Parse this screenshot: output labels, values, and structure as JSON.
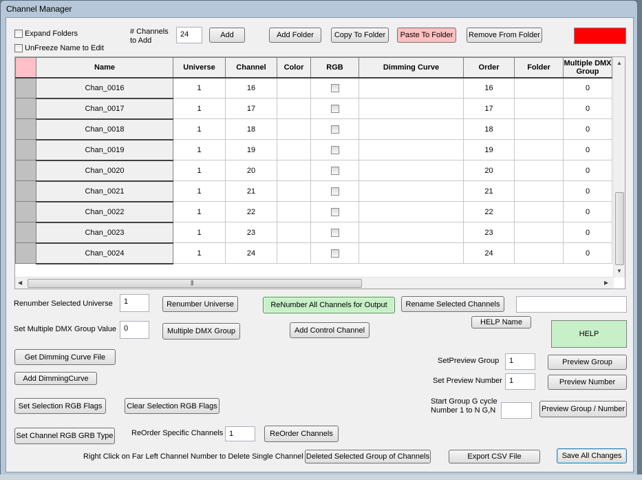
{
  "window": {
    "title": "Channel Manager"
  },
  "top": {
    "expand_folders": "Expand Folders",
    "unfreeze_name": "UnFreeze Name to Edit",
    "channels_to_add_label": "# Channels to Add",
    "channels_to_add_value": "24",
    "add": "Add",
    "add_folder": "Add Folder",
    "copy_to_folder": "Copy To Folder",
    "paste_to_folder": "Paste To Folder",
    "remove_from_folder": "Remove From Folder",
    "color_swatch": "#ff0000"
  },
  "grid": {
    "columns": [
      "",
      "Name",
      "Universe",
      "Channel",
      "Color",
      "RGB",
      "Dimming Curve",
      "Order",
      "Folder",
      "Multiple DMX Group"
    ],
    "rows": [
      {
        "name": "Chan_0016",
        "universe": "1",
        "channel": "16",
        "order": "16",
        "group": "0"
      },
      {
        "name": "Chan_0017",
        "universe": "1",
        "channel": "17",
        "order": "17",
        "group": "0"
      },
      {
        "name": "Chan_0018",
        "universe": "1",
        "channel": "18",
        "order": "18",
        "group": "0"
      },
      {
        "name": "Chan_0019",
        "universe": "1",
        "channel": "19",
        "order": "19",
        "group": "0"
      },
      {
        "name": "Chan_0020",
        "universe": "1",
        "channel": "20",
        "order": "20",
        "group": "0"
      },
      {
        "name": "Chan_0021",
        "universe": "1",
        "channel": "21",
        "order": "21",
        "group": "0"
      },
      {
        "name": "Chan_0022",
        "universe": "1",
        "channel": "22",
        "order": "22",
        "group": "0"
      },
      {
        "name": "Chan_0023",
        "universe": "1",
        "channel": "23",
        "order": "23",
        "group": "0"
      },
      {
        "name": "Chan_0024",
        "universe": "1",
        "channel": "24",
        "order": "24",
        "group": "0"
      }
    ]
  },
  "bottom": {
    "renumber_universe_label": "Renumber Selected Universe",
    "renumber_universe_value": "1",
    "renumber_universe": "Renumber Universe",
    "renumber_all": "ReNumber All Channels for Output",
    "rename_selected": "Rename Selected Channels",
    "rename_value": "",
    "help_name": "HELP Name",
    "help": "HELP",
    "dmx_group_label": "Set Multiple DMX Group Value",
    "dmx_group_value": "0",
    "multiple_dmx_group": "Multiple DMX Group",
    "add_control_channel": "Add Control Channel",
    "get_dimming_curve": "Get Dimming Curve File",
    "add_dimming_curve": "Add DimmingCurve",
    "set_preview_group_label": "SetPreview Group",
    "set_preview_group_value": "1",
    "preview_group": "Preview Group",
    "set_preview_number_label": "Set Preview Number",
    "set_preview_number_value": "1",
    "preview_number": "Preview Number",
    "set_rgb_flags": "Set Selection RGB Flags",
    "clear_rgb_flags": "Clear Selection RGB Flags",
    "start_group_label": "Start Group G cycle Number 1 to N G,N",
    "start_group_value": "",
    "preview_group_number": "Preview Group / Number",
    "set_rgb_grb": "Set Channel RGB GRB Type",
    "reorder_label": "ReOrder Specific Channels",
    "reorder_value": "1",
    "reorder_channels": "ReOrder Channels",
    "right_click_hint": "Right Click on Far Left Channel Number to Delete Single Channel",
    "delete_selected_group": "Deleted Selected Group of Channels",
    "export_csv": "Export CSV File",
    "save_all": "Save All Changes"
  }
}
